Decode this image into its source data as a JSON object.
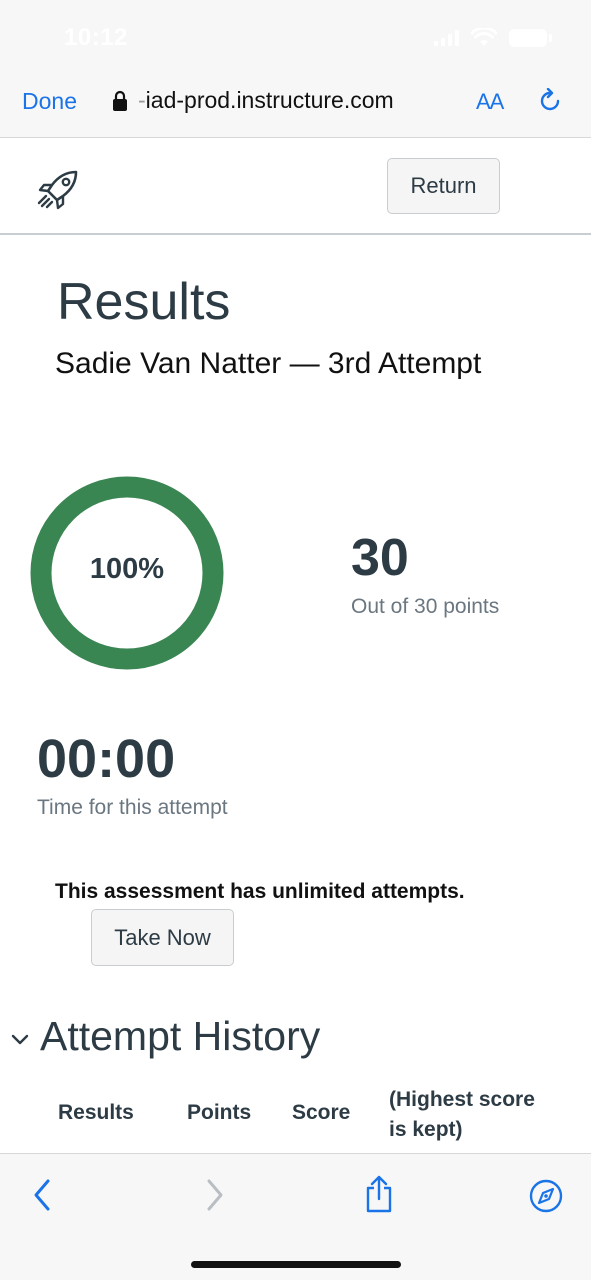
{
  "status_bar": {
    "time": "10:12"
  },
  "browser": {
    "done_label": "Done",
    "url_prefix": "-",
    "url_host": "iad-prod.instructure.com",
    "text_size_label": "AA"
  },
  "header": {
    "return_label": "Return"
  },
  "results": {
    "title": "Results",
    "subtitle": "Sadie Van Natter — 3rd Attempt",
    "percent_label": "100%",
    "percent_value": 1.0,
    "points": "30",
    "points_caption": "Out of 30 points",
    "time": "00:00",
    "time_caption": "Time for this attempt"
  },
  "attempts": {
    "notice": "This assessment has unlimited attempts.",
    "take_now_label": "Take Now"
  },
  "history": {
    "title": "Attempt History",
    "columns": [
      "Results",
      "Points",
      "Score",
      "(Highest score is kept)"
    ]
  },
  "colors": {
    "ring": "#3a8652",
    "accent": "#1a74e8",
    "text": "#2d3b45"
  },
  "icons": [
    "rocket-icon",
    "lock-icon",
    "reload-icon",
    "chevron-down-icon",
    "back-icon",
    "forward-icon",
    "share-icon",
    "compass-icon"
  ]
}
